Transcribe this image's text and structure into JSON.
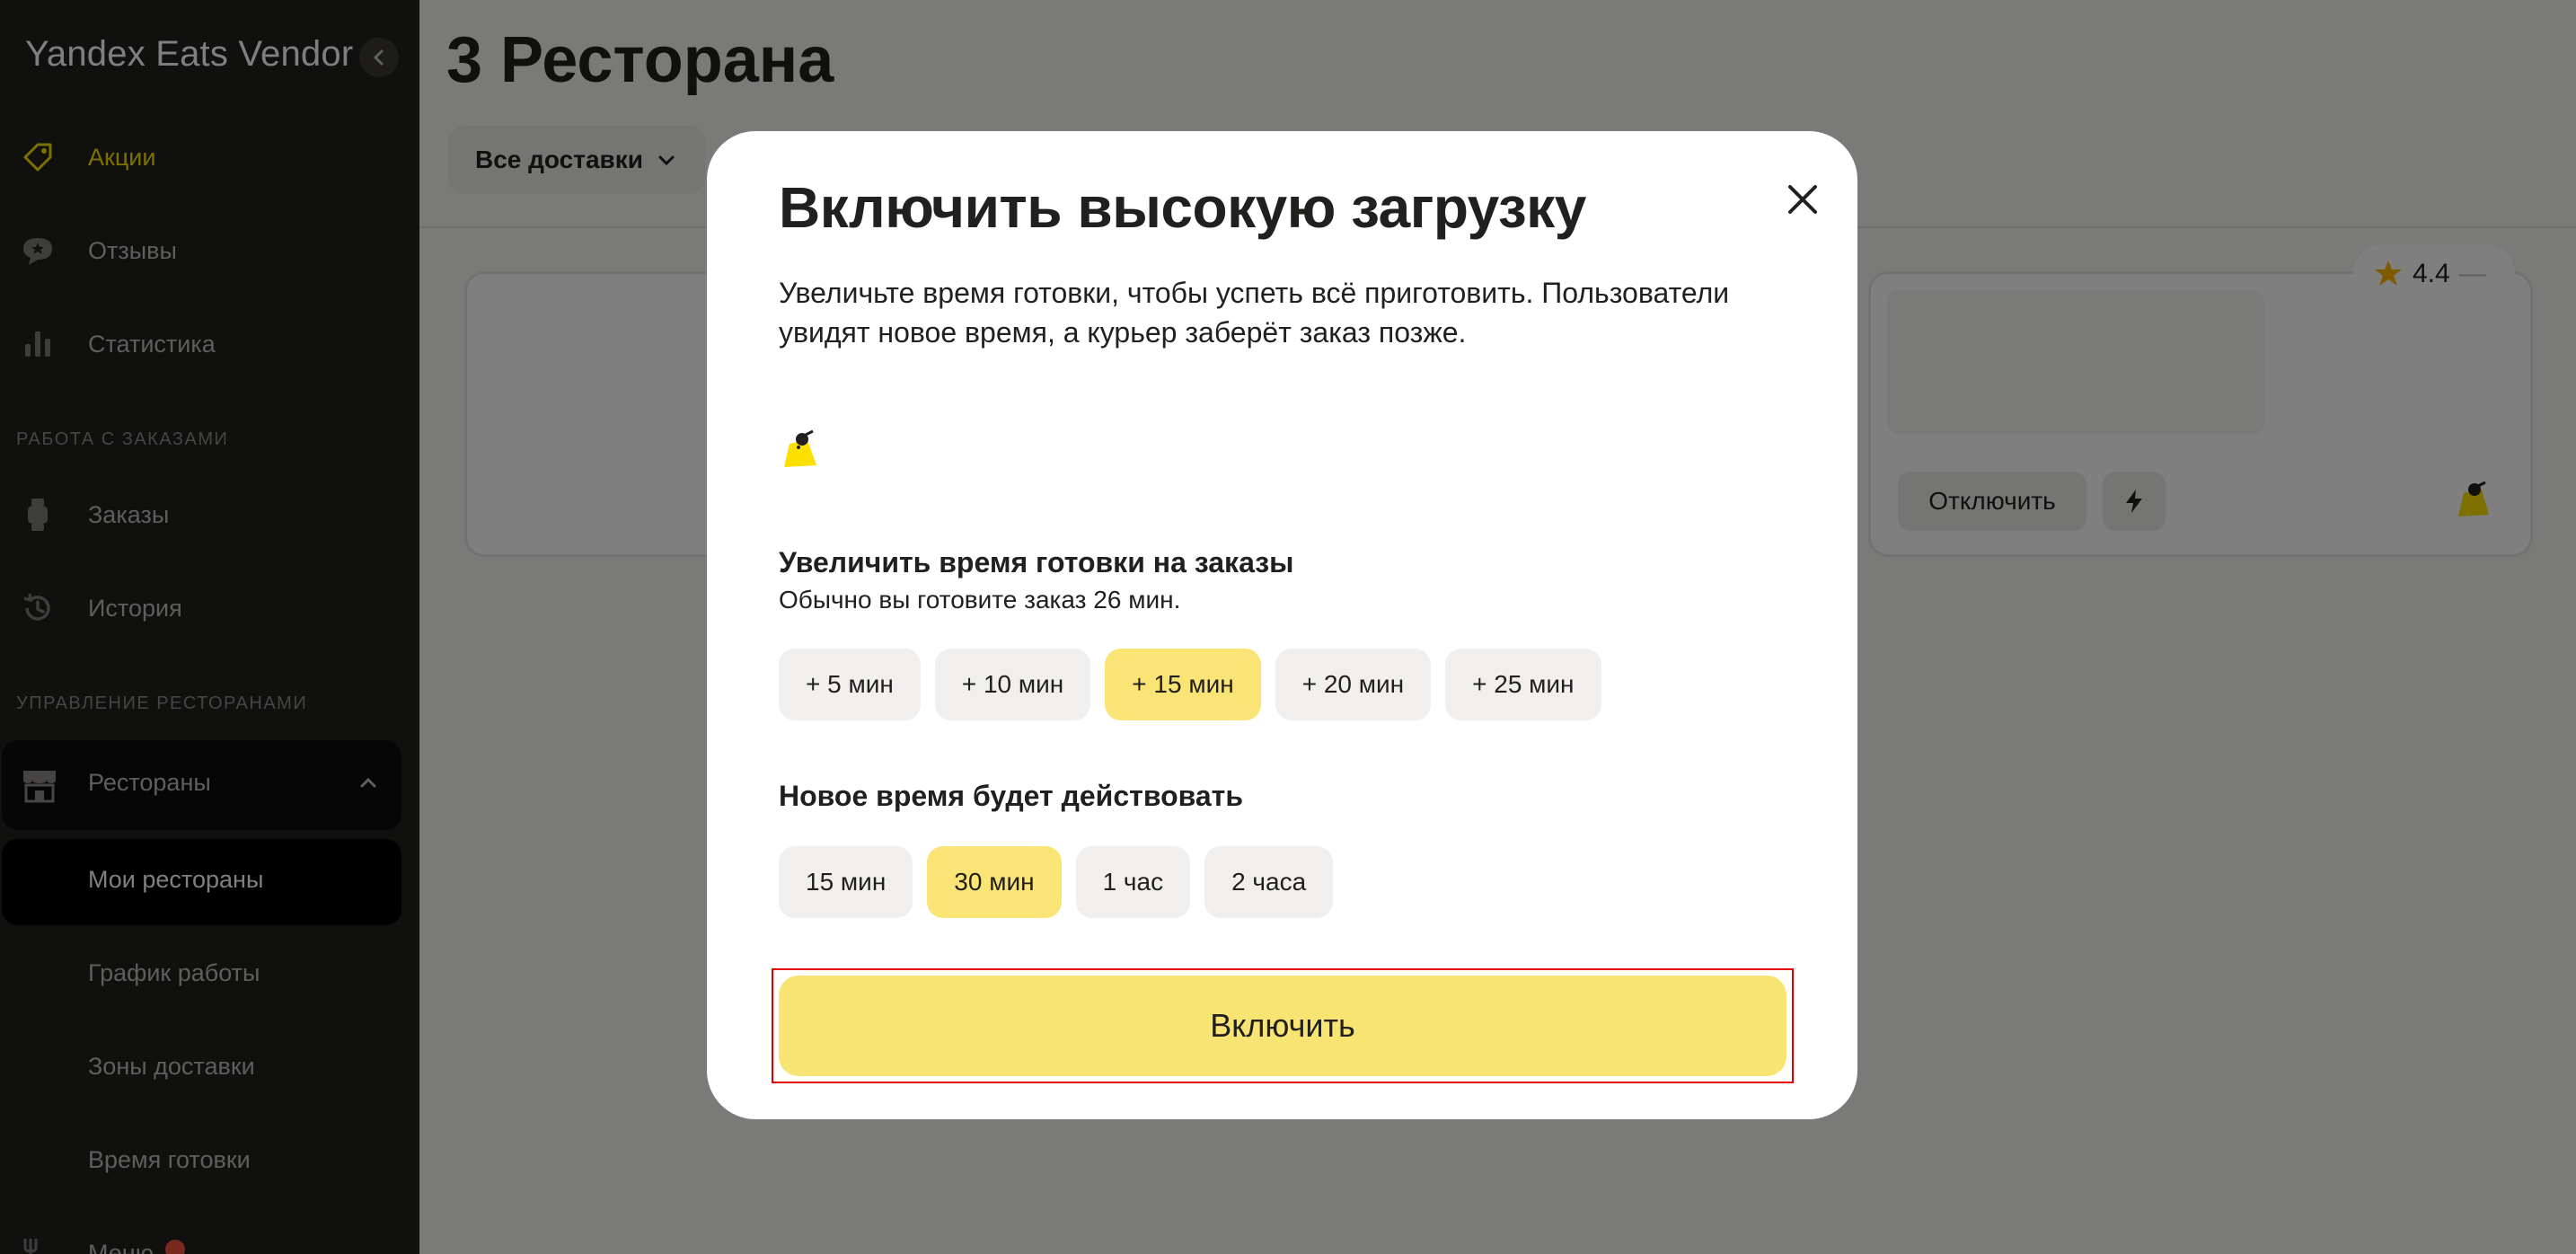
{
  "app": {
    "brand": "Yandex Eats Vendor"
  },
  "sidebar": {
    "items": [
      {
        "label": "Акции",
        "icon": "tag-icon",
        "active": true
      },
      {
        "label": "Отзывы",
        "icon": "review-star-icon"
      },
      {
        "label": "Статистика",
        "icon": "bar-chart-icon"
      }
    ],
    "section_orders": "РАБОТА С ЗАКАЗАМИ",
    "order_items": [
      {
        "label": "Заказы",
        "icon": "watch-icon"
      },
      {
        "label": "История",
        "icon": "history-icon"
      }
    ],
    "section_restaurants": "УПРАВЛЕНИЕ РЕСТОРАНАМИ",
    "restaurants": {
      "label": "Рестораны",
      "icon": "store-icon"
    },
    "sub_items": [
      {
        "label": "Мои рестораны",
        "selected": true
      },
      {
        "label": "График работы"
      },
      {
        "label": "Зоны доставки"
      },
      {
        "label": "Время готовки"
      }
    ],
    "menu_label": "Меню"
  },
  "main": {
    "title": "3 Ресторана",
    "filter_label": "Все доставки",
    "rating": "4.4",
    "card_button": "Отключить"
  },
  "modal": {
    "title": "Включить высокую загрузку",
    "description": "Увеличьте время готовки, чтобы успеть всё приготовить. Пользователи увидят новое время, а курьер заберёт заказ позже.",
    "section1_title": "Увеличить время готовки на заказы",
    "section1_sub": "Обычно вы готовите заказ 26 мин.",
    "increase_options": [
      "+ 5 мин",
      "+ 10 мин",
      "+ 15 мин",
      "+ 20 мин",
      "+ 25 мин"
    ],
    "increase_selected": 2,
    "section2_title": "Новое время будет действовать",
    "duration_options": [
      "15 мин",
      "30 мин",
      "1 час",
      "2 часа"
    ],
    "duration_selected": 1,
    "enable_button": "Включить"
  },
  "colors": {
    "accent": "#fce000",
    "chip_selected": "#fae475",
    "button": "#f8e472",
    "sidebar_bg": "#21201f"
  }
}
